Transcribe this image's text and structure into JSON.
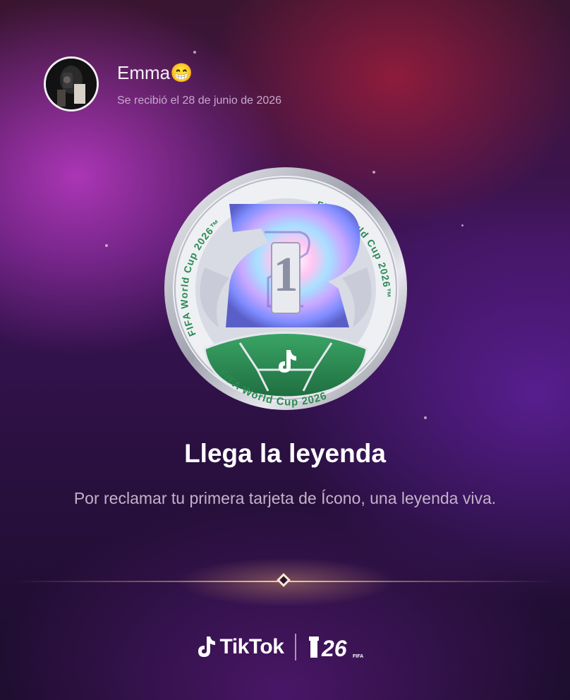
{
  "header": {
    "name": "Emma",
    "emoji": "😁",
    "received": "Se recibió el 28 de junio de 2026"
  },
  "badge": {
    "ring_text_right": "FIFA World Cup 2026™",
    "ring_text_left": "FIFA World Cup 2026™",
    "ring_text_bottom": "FIFA World Cup 2026",
    "number": "1"
  },
  "main": {
    "title": "Llega la leyenda",
    "description": "Por reclamar tu primera tarjeta de Ícono, una leyenda viva."
  },
  "footer": {
    "tiktok": "TikTok",
    "fifa_mark": "26",
    "fifa_small": "FIFA"
  },
  "icons": [
    "avatar",
    "trophy-badge-icon",
    "diamond-icon",
    "tiktok-logo-icon",
    "fifa-26-logo-icon"
  ],
  "colors": {
    "accent_green": "#2c8a52",
    "text_primary": "#ffffff",
    "text_secondary": "#c4b2c9"
  }
}
